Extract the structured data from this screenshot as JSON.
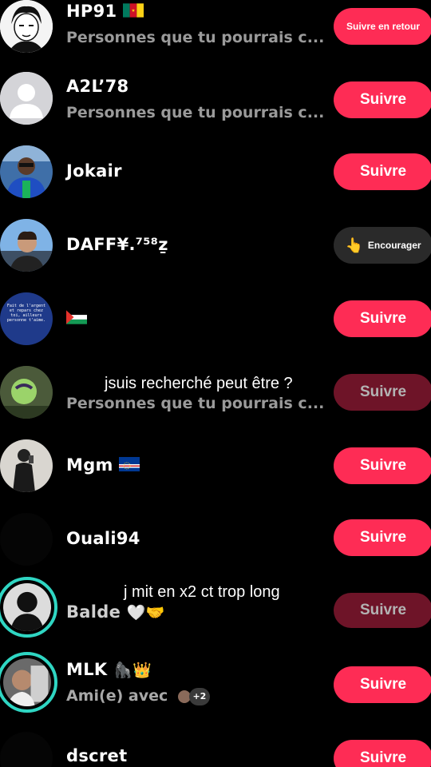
{
  "users": [
    {
      "name": "HP91",
      "subtitle": "Personnes que tu pourrais c...",
      "button": "Suivre en retour",
      "avatar_icon": "anime-boy-avatar",
      "flag": "cameroon-flag"
    },
    {
      "name": "A2L’78",
      "subtitle": "Personnes que tu pourrais c...",
      "button": "Suivre",
      "avatar_icon": "default-user-avatar"
    },
    {
      "name": "Jokair",
      "subtitle": "",
      "button": "Suivre",
      "avatar_icon": "photo-avatar"
    },
    {
      "name": "DAFF¥.⁷⁵⁸ẕ",
      "subtitle": "",
      "button": "Encourager",
      "avatar_icon": "photo-avatar",
      "button_icon": "pointing-hand-icon"
    },
    {
      "name": "",
      "subtitle": "",
      "button": "Suivre",
      "avatar_icon": "text-image-avatar",
      "flag": "palestine-flag",
      "avatar_text": "Fait de l'argent et repars chez toi, ailleurs personne t'aime."
    },
    {
      "name": "",
      "subtitle": "Personnes que tu pourrais c...",
      "button": "Suivre",
      "avatar_icon": "photo-avatar"
    },
    {
      "name": "Mgm",
      "subtitle": "",
      "button": "Suivre",
      "avatar_icon": "photo-avatar",
      "flag": "cape-verde-flag"
    },
    {
      "name": "Ouali94",
      "subtitle": "",
      "button": "Suivre",
      "avatar_icon": "dark-avatar"
    },
    {
      "name": "Balde",
      "subtitle": "",
      "button": "Suivre",
      "avatar_icon": "photo-avatar",
      "emoji": "white-heart-handshake-icon"
    },
    {
      "name": "MLK",
      "subtitle": "Ami(e) avec",
      "button": "Suivre",
      "avatar_icon": "photo-avatar",
      "emoji": "gorilla-crown-icon",
      "mutual_count": "+2"
    },
    {
      "name": "dscret",
      "subtitle": "",
      "button": "Suivre",
      "avatar_icon": "dark-avatar"
    }
  ],
  "overlays": {
    "caption_1": "jsuis recherché peut être ?",
    "caption_2": "j mit en x2 ct trop long"
  },
  "colors": {
    "accent": "#fe2c55",
    "background": "#000000",
    "ring": "#2fd6c3"
  }
}
